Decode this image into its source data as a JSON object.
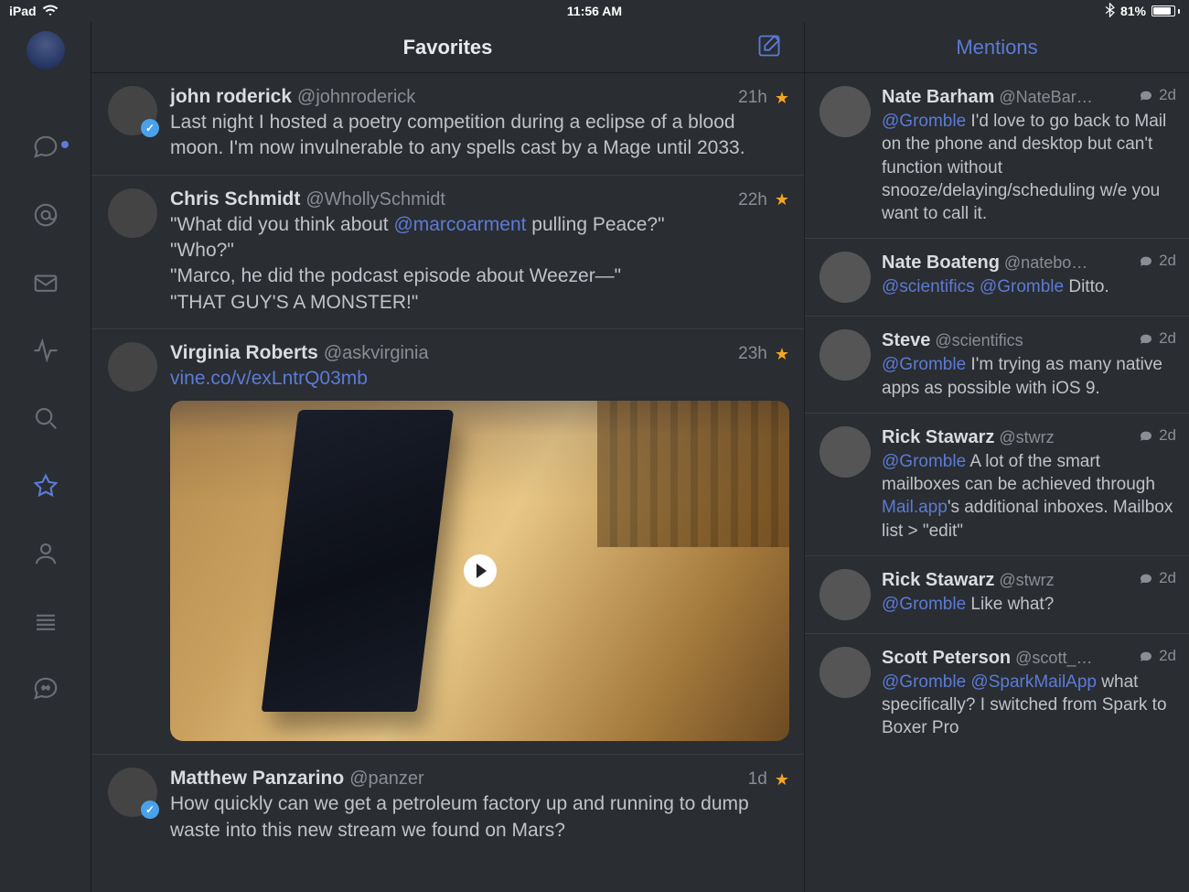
{
  "status": {
    "device": "iPad",
    "time": "11:56 AM",
    "battery_pct": "81%"
  },
  "main": {
    "title": "Favorites"
  },
  "mentions": {
    "title": "Mentions"
  },
  "tweets": [
    {
      "name": "john roderick",
      "handle": "@johnroderick",
      "time": "21h",
      "verified": true,
      "text": "Last night I hosted a poetry competition during a eclipse of a blood moon. I'm now invulnerable to any spells cast by a Mage until 2033."
    },
    {
      "name": "Chris Schmidt",
      "handle": "@WhollySchmidt",
      "time": "22h",
      "verified": false,
      "text_pre": "\"What did you think about ",
      "mention": "@marcoarment",
      "text_post": " pulling Peace?\"\n\"Who?\"\n\"Marco, he did the podcast episode about Weezer—\"\n\"THAT GUY'S A MONSTER!\""
    },
    {
      "name": "Virginia Roberts",
      "handle": "@askvirginia",
      "time": "23h",
      "verified": false,
      "link": "vine.co/v/exLntrQ03mb"
    },
    {
      "name": "Matthew Panzarino",
      "handle": "@panzer",
      "time": "1d",
      "verified": true,
      "text": "How quickly can we get a petroleum factory up and running to dump waste into this new stream we found on Mars?"
    }
  ],
  "mentions_list": [
    {
      "name": "Nate Barham",
      "handle": "@NateBar…",
      "time": "2d",
      "mention": "@Gromble",
      "text": " I'd love to go back to Mail on the phone and desktop but can't function without snooze/delaying/scheduling w/e you want to call it."
    },
    {
      "name": "Nate Boateng",
      "handle": "@natebo…",
      "time": "2d",
      "mentions_html": "@scientifics @Gromble",
      "text": " Ditto."
    },
    {
      "name": "Steve",
      "handle": "@scientifics",
      "time": "2d",
      "mention": "@Gromble",
      "text": " I'm trying as many native apps as possible with iOS 9."
    },
    {
      "name": "Rick Stawarz",
      "handle": "@stwrz",
      "time": "2d",
      "mention": "@Gromble",
      "text_pre": " A lot of the smart mailboxes can be achieved through ",
      "link": "Mail.app",
      "text_post": "'s additional inboxes. Mailbox list > \"edit\""
    },
    {
      "name": "Rick Stawarz",
      "handle": "@stwrz",
      "time": "2d",
      "mention": "@Gromble",
      "text": " Like what?"
    },
    {
      "name": "Scott Peterson",
      "handle": "@scott_…",
      "time": "2d",
      "mentions_html": "@Gromble @SparkMailApp",
      "text": " what specifically? I switched from Spark to Boxer Pro"
    }
  ]
}
